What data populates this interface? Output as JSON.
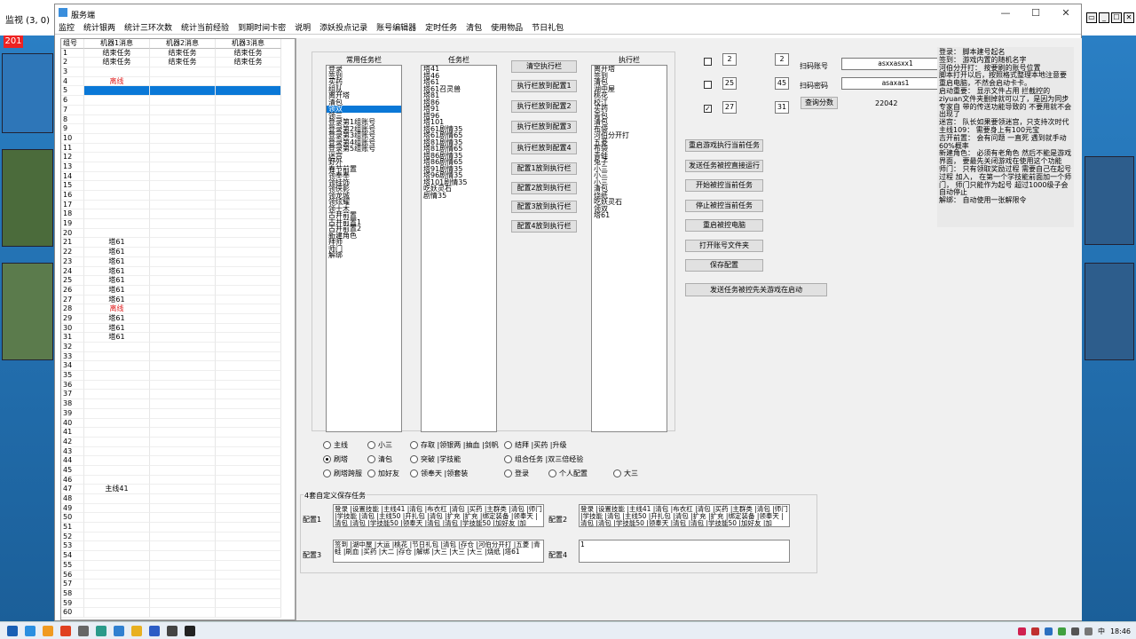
{
  "outer": {
    "title": "监视 (3, 0)",
    "badge": "201"
  },
  "app": {
    "title": "服务端",
    "win_min": "—",
    "win_max": "☐",
    "win_close": "✕"
  },
  "menu": [
    "监控",
    "统计银两",
    "统计三环次数",
    "统计当前经验",
    "到期时间卡密",
    "说明",
    "添妖投点记录",
    "账号编辑器",
    "定时任务",
    "清包",
    "使用物品",
    "节日礼包"
  ],
  "grid": {
    "headers": [
      "组号",
      "机器1消息",
      "机器2消息",
      "机器3消息"
    ],
    "rows": [
      {
        "n": "1",
        "a": "结束任务",
        "b": "结束任务",
        "c": "结束任务"
      },
      {
        "n": "2",
        "a": "结束任务",
        "b": "结束任务",
        "c": "结束任务"
      },
      {
        "n": "3",
        "a": "",
        "b": "",
        "c": ""
      },
      {
        "n": "4",
        "a": "离线",
        "b": "",
        "c": "",
        "red": true
      },
      {
        "n": "5",
        "a": "",
        "b": "",
        "c": "",
        "sel": true
      },
      {
        "n": "6",
        "a": "",
        "b": "",
        "c": ""
      },
      {
        "n": "7",
        "a": "",
        "b": "",
        "c": ""
      },
      {
        "n": "8",
        "a": "",
        "b": "",
        "c": ""
      },
      {
        "n": "9",
        "a": "",
        "b": "",
        "c": ""
      },
      {
        "n": "10",
        "a": "",
        "b": "",
        "c": ""
      },
      {
        "n": "11",
        "a": "",
        "b": "",
        "c": ""
      },
      {
        "n": "12",
        "a": "",
        "b": "",
        "c": ""
      },
      {
        "n": "13",
        "a": "",
        "b": "",
        "c": ""
      },
      {
        "n": "14",
        "a": "",
        "b": "",
        "c": ""
      },
      {
        "n": "15",
        "a": "",
        "b": "",
        "c": ""
      },
      {
        "n": "16",
        "a": "",
        "b": "",
        "c": ""
      },
      {
        "n": "17",
        "a": "",
        "b": "",
        "c": ""
      },
      {
        "n": "18",
        "a": "",
        "b": "",
        "c": ""
      },
      {
        "n": "19",
        "a": "",
        "b": "",
        "c": ""
      },
      {
        "n": "20",
        "a": "",
        "b": "",
        "c": ""
      },
      {
        "n": "21",
        "a": "塔61",
        "b": "",
        "c": ""
      },
      {
        "n": "22",
        "a": "塔61",
        "b": "",
        "c": ""
      },
      {
        "n": "23",
        "a": "塔61",
        "b": "",
        "c": ""
      },
      {
        "n": "24",
        "a": "塔61",
        "b": "",
        "c": ""
      },
      {
        "n": "25",
        "a": "塔61",
        "b": "",
        "c": ""
      },
      {
        "n": "26",
        "a": "塔61",
        "b": "",
        "c": ""
      },
      {
        "n": "27",
        "a": "塔61",
        "b": "",
        "c": ""
      },
      {
        "n": "28",
        "a": "离线",
        "b": "",
        "c": "",
        "red": true
      },
      {
        "n": "29",
        "a": "塔61",
        "b": "",
        "c": ""
      },
      {
        "n": "30",
        "a": "塔61",
        "b": "",
        "c": ""
      },
      {
        "n": "31",
        "a": "塔61",
        "b": "",
        "c": ""
      },
      {
        "n": "32",
        "a": "",
        "b": "",
        "c": ""
      },
      {
        "n": "33",
        "a": "",
        "b": "",
        "c": ""
      },
      {
        "n": "34",
        "a": "",
        "b": "",
        "c": ""
      },
      {
        "n": "35",
        "a": "",
        "b": "",
        "c": ""
      },
      {
        "n": "36",
        "a": "",
        "b": "",
        "c": ""
      },
      {
        "n": "37",
        "a": "",
        "b": "",
        "c": ""
      },
      {
        "n": "38",
        "a": "",
        "b": "",
        "c": ""
      },
      {
        "n": "39",
        "a": "",
        "b": "",
        "c": ""
      },
      {
        "n": "40",
        "a": "",
        "b": "",
        "c": ""
      },
      {
        "n": "41",
        "a": "",
        "b": "",
        "c": ""
      },
      {
        "n": "42",
        "a": "",
        "b": "",
        "c": ""
      },
      {
        "n": "43",
        "a": "",
        "b": "",
        "c": ""
      },
      {
        "n": "44",
        "a": "",
        "b": "",
        "c": ""
      },
      {
        "n": "45",
        "a": "",
        "b": "",
        "c": ""
      },
      {
        "n": "46",
        "a": "",
        "b": "",
        "c": ""
      },
      {
        "n": "47",
        "a": "主线41",
        "b": "",
        "c": ""
      },
      {
        "n": "48",
        "a": "",
        "b": "",
        "c": ""
      },
      {
        "n": "49",
        "a": "",
        "b": "",
        "c": ""
      },
      {
        "n": "50",
        "a": "",
        "b": "",
        "c": ""
      },
      {
        "n": "51",
        "a": "",
        "b": "",
        "c": ""
      },
      {
        "n": "52",
        "a": "",
        "b": "",
        "c": ""
      },
      {
        "n": "53",
        "a": "",
        "b": "",
        "c": ""
      },
      {
        "n": "54",
        "a": "",
        "b": "",
        "c": ""
      },
      {
        "n": "55",
        "a": "",
        "b": "",
        "c": ""
      },
      {
        "n": "56",
        "a": "",
        "b": "",
        "c": ""
      },
      {
        "n": "57",
        "a": "",
        "b": "",
        "c": ""
      },
      {
        "n": "58",
        "a": "",
        "b": "",
        "c": ""
      },
      {
        "n": "59",
        "a": "",
        "b": "",
        "c": ""
      },
      {
        "n": "60",
        "a": "",
        "b": "",
        "c": ""
      }
    ]
  },
  "lists": {
    "common": {
      "label": "常用任务栏",
      "items": [
        "登录",
        "签到",
        "买药",
        "组队",
        "离开塔",
        "清包",
        "领双",
        "领三",
        "登录第1组账号",
        "登录第2组账号",
        "登录第3组账号",
        "登录第4组账号",
        "登录第5组账号",
        "迷宫",
        "野外",
        "春节前置",
        "领奉奉",
        "领挂饰",
        "领侠影",
        "领龙城",
        "领炫耀",
        "领士木",
        "古井前置",
        "古井前置1",
        "古井前置2",
        "新建角色",
        "拜师",
        "师门",
        "解绑"
      ],
      "selected": 6
    },
    "task": {
      "label": "任务栏",
      "items": [
        "塔41",
        "塔46",
        "塔61",
        "塔61召灵兽",
        "塔81",
        "塔86",
        "塔91",
        "塔96",
        "塔101",
        "塔61剧情35",
        "塔61剧情65",
        "塔81剧情35",
        "塔81剧情65",
        "塔86剧情35",
        "塔86剧情65",
        "塔91剧情35",
        "塔96剧情35",
        "塔101剧情35",
        "吃妖灵石",
        "剧情35"
      ]
    },
    "exec": {
      "label": "执行栏",
      "items": [
        "离开塔",
        "签到",
        "清包",
        "湖中屋",
        "桃花",
        "校江",
        "买药",
        "青包",
        "清包",
        "布袋",
        "河伯分开打",
        "五菱",
        "布袋",
        "青蛙",
        "兔子",
        "小三",
        "小三",
        "小三",
        "清包",
        "烧纸",
        "吃妖灵石",
        "领双",
        "塔61"
      ]
    }
  },
  "mid_buttons": [
    "清空执行栏",
    "执行栏放到配置1",
    "执行栏放到配置2",
    "执行栏放到配置3",
    "执行栏放到配置4",
    "配置1放到执行栏",
    "配置2放到执行栏",
    "配置3放到执行栏",
    "配置4放到执行栏"
  ],
  "radios": [
    {
      "label": "主线",
      "on": false
    },
    {
      "label": "小三",
      "on": false
    },
    {
      "label": "存取 |领银两 |抽血 |剑帆",
      "on": false
    },
    {
      "label": "结拜 |买药 |升级",
      "on": false
    },
    {
      "label": "刷塔",
      "on": true
    },
    {
      "label": "清包",
      "on": false
    },
    {
      "label": "突破 |学技能",
      "on": false
    },
    {
      "label": "组合任务 |双三倍经验",
      "on": false
    },
    {
      "label": "刷塔跨服",
      "on": false
    },
    {
      "label": "加好友",
      "on": false
    },
    {
      "label": "领奉天 |领套装",
      "on": false
    },
    {
      "label": "登录",
      "on": false
    },
    {
      "label": "个人配置",
      "on": false
    },
    {
      "label": "大三",
      "on": false
    }
  ],
  "save_group": {
    "legend": "4套自定义保存任务",
    "labels": [
      "配置1",
      "配置2",
      "配置3",
      "配置4"
    ],
    "cfg1": "登录 |设置技能 |主线41 |清包 |布衣杠 |清包 |买药 |主群类 |清包 |师门 |学技能 |清包 |主线50 |开扎包 |清包 |扩充 |扩充 |绑定装备 |领奉天 |清包 |清包 |学技能50 |领奉天 |清包 |清包 |学技能50 |加好友 |加",
    "cfg2": "登录 |设置技能 |主线41 |清包 |布衣杠 |清包 |买药 |主群类 |清包 |师门 |学技能 |清包 |主线50 |开扎包 |清包 |扩充 |扩充 |绑定装备 |领奉天 |清包 |清包 |学技能50 |领奉天 |清包 |清包 |学技能50 |加好友 |加",
    "cfg3": "签到 |湖中屋 |大运 |桃花 |节日礼包 |清包 |存仓 |河伯分开打 |五菱 |青蛙 |刷血 |买药 |大二 |存仓 |解绑 |大三 |大三 |大三 |烧纸 |塔61",
    "cfg4": "1"
  },
  "counters": [
    {
      "checked": false,
      "check_mark": "",
      "a": "2",
      "b": "2"
    },
    {
      "checked": false,
      "check_mark": "",
      "a": "25",
      "b": "45"
    },
    {
      "checked": true,
      "check_mark": "✓",
      "a": "27",
      "b": "31"
    }
  ],
  "scan": {
    "account_label": "扫码账号",
    "account_value": "asxxasxx1",
    "password_label": "扫码密码",
    "password_value": "asaxas1",
    "query_btn": "查询分数",
    "score": "22042"
  },
  "right_buttons": [
    "重启游戏执行当前任务",
    "发送任务被控直接运行",
    "开始被控当前任务",
    "停止被控当前任务",
    "重启被控电脑",
    "打开账号文件夹",
    "保存配置"
  ],
  "wide_button": "发送任务被控先关游戏在启动",
  "notes": "登录： 脚本建号起名\n签到： 游戏内置的随机名字\n河伯分开打： 按要刷的账号位置\n脚本打开以后，按照格式整理本地注意要重启电脑，不然会启动卡卡。\n启动重要： 显示文件占用 拦截控的ziyuan文件夹删掉就可以了，是因为同步专家自 带的传送功能导致的 不要用就不会出现了\n迷宫： 队长如果要领迷宫，只支持次时代 主线109： 需要身上有100元宝\n吉开前置： 会有问题 一直死 遇到就手动 60%概率\n新建角色： 必须有老角色 然后不能是游戏界面， 要最先关闭游戏在使用这个功能\n师门： 只有领取奖励过程 需要自己在起号过程 加入， 在第一个学技能前面加一个师门， 师门只能作为起号 超过1000级子会自动停止\n解绑： 自动使用一张解限令",
  "tray": {
    "lang": "中",
    "time": "18:46"
  },
  "colors": {
    "selection": "#0a78d7",
    "offline": "#e02020",
    "desktop": "#1f6fae"
  }
}
